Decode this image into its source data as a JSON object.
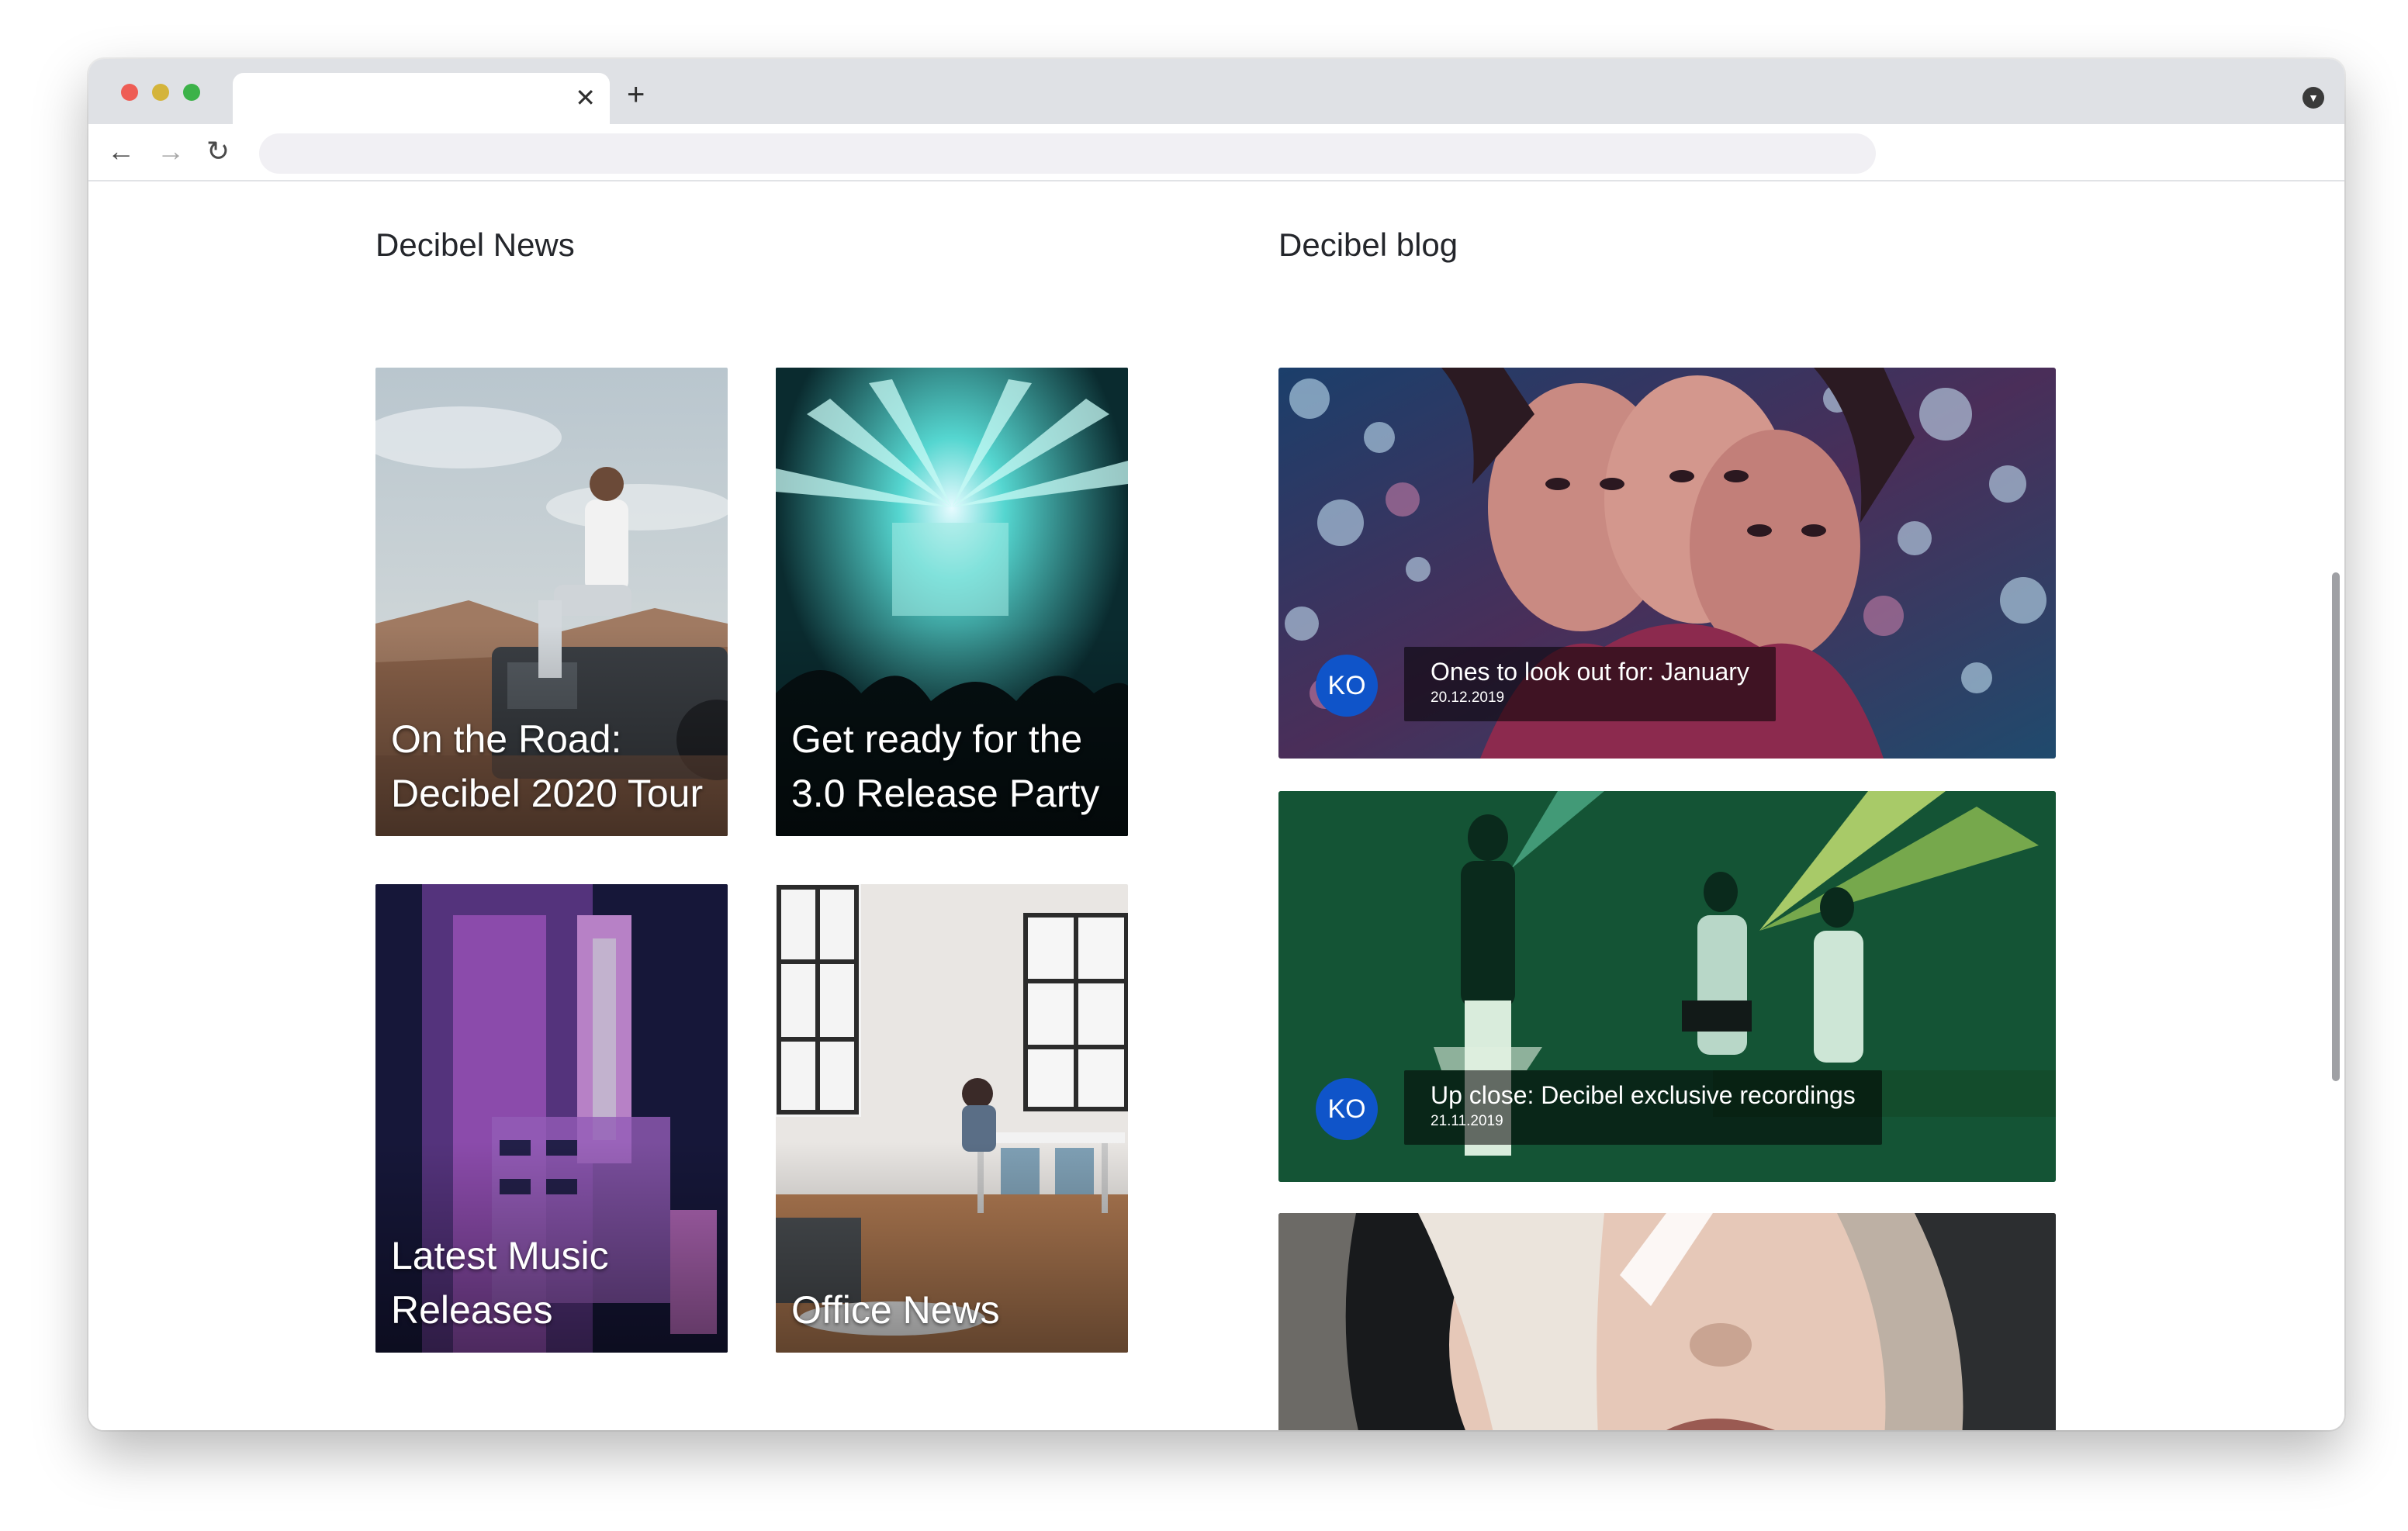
{
  "browser": {
    "tab_close_glyph": "✕",
    "new_tab_glyph": "+",
    "menu_glyph": "▼",
    "nav": {
      "back": "←",
      "forward": "→",
      "reload": "↻"
    },
    "address_value": ""
  },
  "news": {
    "title": "Decibel News",
    "cards": [
      {
        "label": "On the Road: Decibel 2020 Tour"
      },
      {
        "label": "Get ready for the 3.0 Release Party"
      },
      {
        "label": "Latest Music Releases"
      },
      {
        "label": "Office News"
      }
    ]
  },
  "blog": {
    "title": "Decibel blog",
    "posts": [
      {
        "avatar": "KO",
        "title": "Ones to look out for: January",
        "date": "20.12.2019"
      },
      {
        "avatar": "KO",
        "title": "Up close: Decibel exclusive recordings",
        "date": "21.11.2019"
      }
    ]
  },
  "colors": {
    "avatar_bg": "#0f54c9",
    "page_bg": "#ffffff",
    "heading": "#24262b"
  }
}
